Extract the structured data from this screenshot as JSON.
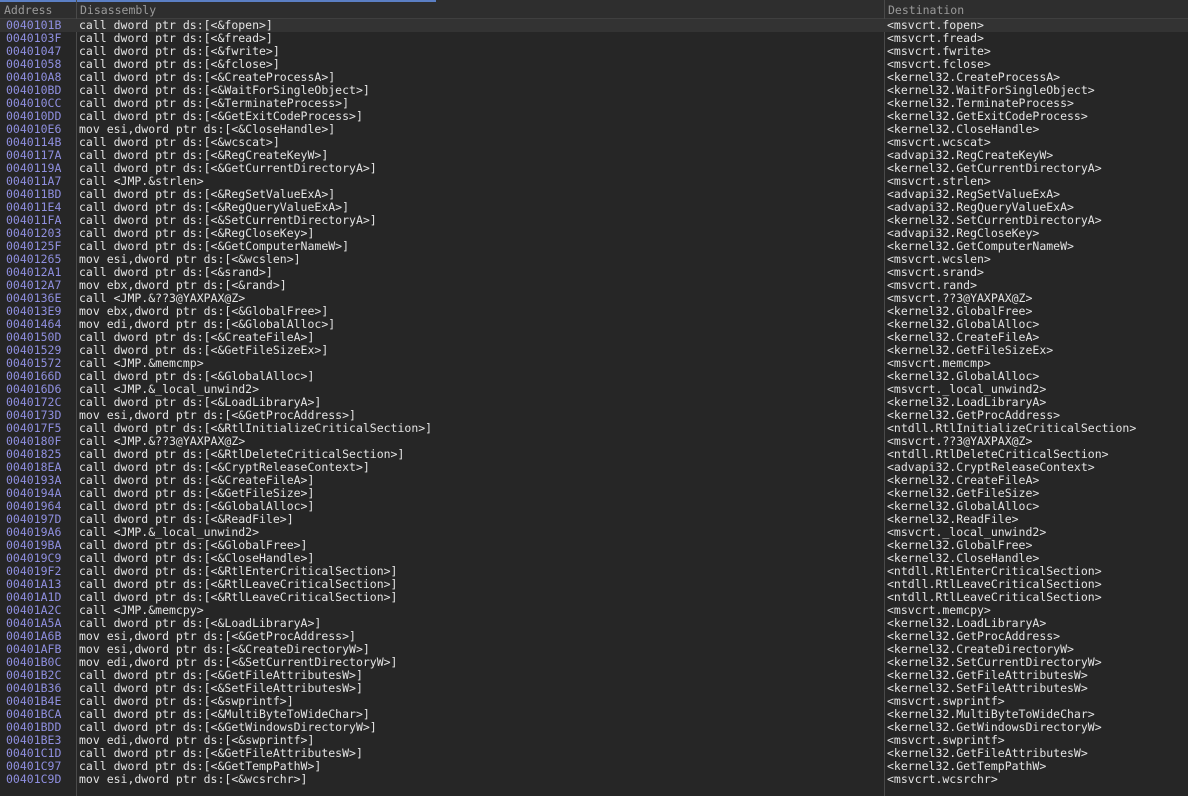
{
  "header": {
    "address": "Address",
    "disassembly": "Disassembly",
    "destination": "Destination"
  },
  "rows": [
    {
      "addr": "0040101B",
      "dis": "call dword ptr ds:[<&fopen>]",
      "dest": "<msvcrt.fopen>"
    },
    {
      "addr": "0040103F",
      "dis": "call dword ptr ds:[<&fread>]",
      "dest": "<msvcrt.fread>"
    },
    {
      "addr": "00401047",
      "dis": "call dword ptr ds:[<&fwrite>]",
      "dest": "<msvcrt.fwrite>"
    },
    {
      "addr": "00401058",
      "dis": "call dword ptr ds:[<&fclose>]",
      "dest": "<msvcrt.fclose>"
    },
    {
      "addr": "004010A8",
      "dis": "call dword ptr ds:[<&CreateProcessA>]",
      "dest": "<kernel32.CreateProcessA>"
    },
    {
      "addr": "004010BD",
      "dis": "call dword ptr ds:[<&WaitForSingleObject>]",
      "dest": "<kernel32.WaitForSingleObject>"
    },
    {
      "addr": "004010CC",
      "dis": "call dword ptr ds:[<&TerminateProcess>]",
      "dest": "<kernel32.TerminateProcess>"
    },
    {
      "addr": "004010DD",
      "dis": "call dword ptr ds:[<&GetExitCodeProcess>]",
      "dest": "<kernel32.GetExitCodeProcess>"
    },
    {
      "addr": "004010E6",
      "dis": "mov esi,dword ptr ds:[<&CloseHandle>]",
      "dest": "<kernel32.CloseHandle>"
    },
    {
      "addr": "0040114B",
      "dis": "call dword ptr ds:[<&wcscat>]",
      "dest": "<msvcrt.wcscat>"
    },
    {
      "addr": "0040117A",
      "dis": "call dword ptr ds:[<&RegCreateKeyW>]",
      "dest": "<advapi32.RegCreateKeyW>"
    },
    {
      "addr": "0040119A",
      "dis": "call dword ptr ds:[<&GetCurrentDirectoryA>]",
      "dest": "<kernel32.GetCurrentDirectoryA>"
    },
    {
      "addr": "004011A7",
      "dis": "call <JMP.&strlen>",
      "dest": "<msvcrt.strlen>"
    },
    {
      "addr": "004011BD",
      "dis": "call dword ptr ds:[<&RegSetValueExA>]",
      "dest": "<advapi32.RegSetValueExA>"
    },
    {
      "addr": "004011E4",
      "dis": "call dword ptr ds:[<&RegQueryValueExA>]",
      "dest": "<advapi32.RegQueryValueExA>"
    },
    {
      "addr": "004011FA",
      "dis": "call dword ptr ds:[<&SetCurrentDirectoryA>]",
      "dest": "<kernel32.SetCurrentDirectoryA>"
    },
    {
      "addr": "00401203",
      "dis": "call dword ptr ds:[<&RegCloseKey>]",
      "dest": "<advapi32.RegCloseKey>"
    },
    {
      "addr": "0040125F",
      "dis": "call dword ptr ds:[<&GetComputerNameW>]",
      "dest": "<kernel32.GetComputerNameW>"
    },
    {
      "addr": "00401265",
      "dis": "mov esi,dword ptr ds:[<&wcslen>]",
      "dest": "<msvcrt.wcslen>"
    },
    {
      "addr": "004012A1",
      "dis": "call dword ptr ds:[<&srand>]",
      "dest": "<msvcrt.srand>"
    },
    {
      "addr": "004012A7",
      "dis": "mov ebx,dword ptr ds:[<&rand>]",
      "dest": "<msvcrt.rand>"
    },
    {
      "addr": "0040136E",
      "dis": "call <JMP.&??3@YAXPAX@Z>",
      "dest": "<msvcrt.??3@YAXPAX@Z>"
    },
    {
      "addr": "004013E9",
      "dis": "mov ebx,dword ptr ds:[<&GlobalFree>]",
      "dest": "<kernel32.GlobalFree>"
    },
    {
      "addr": "00401464",
      "dis": "mov edi,dword ptr ds:[<&GlobalAlloc>]",
      "dest": "<kernel32.GlobalAlloc>"
    },
    {
      "addr": "0040150D",
      "dis": "call dword ptr ds:[<&CreateFileA>]",
      "dest": "<kernel32.CreateFileA>"
    },
    {
      "addr": "00401529",
      "dis": "call dword ptr ds:[<&GetFileSizeEx>]",
      "dest": "<kernel32.GetFileSizeEx>"
    },
    {
      "addr": "00401572",
      "dis": "call <JMP.&memcmp>",
      "dest": "<msvcrt.memcmp>"
    },
    {
      "addr": "0040166D",
      "dis": "call dword ptr ds:[<&GlobalAlloc>]",
      "dest": "<kernel32.GlobalAlloc>"
    },
    {
      "addr": "004016D6",
      "dis": "call <JMP.&_local_unwind2>",
      "dest": "<msvcrt._local_unwind2>"
    },
    {
      "addr": "0040172C",
      "dis": "call dword ptr ds:[<&LoadLibraryA>]",
      "dest": "<kernel32.LoadLibraryA>"
    },
    {
      "addr": "0040173D",
      "dis": "mov esi,dword ptr ds:[<&GetProcAddress>]",
      "dest": "<kernel32.GetProcAddress>"
    },
    {
      "addr": "004017F5",
      "dis": "call dword ptr ds:[<&RtlInitializeCriticalSection>]",
      "dest": "<ntdll.RtlInitializeCriticalSection>"
    },
    {
      "addr": "0040180F",
      "dis": "call <JMP.&??3@YAXPAX@Z>",
      "dest": "<msvcrt.??3@YAXPAX@Z>"
    },
    {
      "addr": "00401825",
      "dis": "call dword ptr ds:[<&RtlDeleteCriticalSection>]",
      "dest": "<ntdll.RtlDeleteCriticalSection>"
    },
    {
      "addr": "004018EA",
      "dis": "call dword ptr ds:[<&CryptReleaseContext>]",
      "dest": "<advapi32.CryptReleaseContext>"
    },
    {
      "addr": "0040193A",
      "dis": "call dword ptr ds:[<&CreateFileA>]",
      "dest": "<kernel32.CreateFileA>"
    },
    {
      "addr": "0040194A",
      "dis": "call dword ptr ds:[<&GetFileSize>]",
      "dest": "<kernel32.GetFileSize>"
    },
    {
      "addr": "00401964",
      "dis": "call dword ptr ds:[<&GlobalAlloc>]",
      "dest": "<kernel32.GlobalAlloc>"
    },
    {
      "addr": "0040197D",
      "dis": "call dword ptr ds:[<&ReadFile>]",
      "dest": "<kernel32.ReadFile>"
    },
    {
      "addr": "004019A6",
      "dis": "call <JMP.&_local_unwind2>",
      "dest": "<msvcrt._local_unwind2>"
    },
    {
      "addr": "004019BA",
      "dis": "call dword ptr ds:[<&GlobalFree>]",
      "dest": "<kernel32.GlobalFree>"
    },
    {
      "addr": "004019C9",
      "dis": "call dword ptr ds:[<&CloseHandle>]",
      "dest": "<kernel32.CloseHandle>"
    },
    {
      "addr": "004019F2",
      "dis": "call dword ptr ds:[<&RtlEnterCriticalSection>]",
      "dest": "<ntdll.RtlEnterCriticalSection>"
    },
    {
      "addr": "00401A13",
      "dis": "call dword ptr ds:[<&RtlLeaveCriticalSection>]",
      "dest": "<ntdll.RtlLeaveCriticalSection>"
    },
    {
      "addr": "00401A1D",
      "dis": "call dword ptr ds:[<&RtlLeaveCriticalSection>]",
      "dest": "<ntdll.RtlLeaveCriticalSection>"
    },
    {
      "addr": "00401A2C",
      "dis": "call <JMP.&memcpy>",
      "dest": "<msvcrt.memcpy>"
    },
    {
      "addr": "00401A5A",
      "dis": "call dword ptr ds:[<&LoadLibraryA>]",
      "dest": "<kernel32.LoadLibraryA>"
    },
    {
      "addr": "00401A6B",
      "dis": "mov esi,dword ptr ds:[<&GetProcAddress>]",
      "dest": "<kernel32.GetProcAddress>"
    },
    {
      "addr": "00401AFB",
      "dis": "mov esi,dword ptr ds:[<&CreateDirectoryW>]",
      "dest": "<kernel32.CreateDirectoryW>"
    },
    {
      "addr": "00401B0C",
      "dis": "mov edi,dword ptr ds:[<&SetCurrentDirectoryW>]",
      "dest": "<kernel32.SetCurrentDirectoryW>"
    },
    {
      "addr": "00401B2C",
      "dis": "call dword ptr ds:[<&GetFileAttributesW>]",
      "dest": "<kernel32.GetFileAttributesW>"
    },
    {
      "addr": "00401B36",
      "dis": "call dword ptr ds:[<&SetFileAttributesW>]",
      "dest": "<kernel32.SetFileAttributesW>"
    },
    {
      "addr": "00401B4E",
      "dis": "call dword ptr ds:[<&swprintf>]",
      "dest": "<msvcrt.swprintf>"
    },
    {
      "addr": "00401BCA",
      "dis": "call dword ptr ds:[<&MultiByteToWideChar>]",
      "dest": "<kernel32.MultiByteToWideChar>"
    },
    {
      "addr": "00401BDD",
      "dis": "call dword ptr ds:[<&GetWindowsDirectoryW>]",
      "dest": "<kernel32.GetWindowsDirectoryW>"
    },
    {
      "addr": "00401BE3",
      "dis": "mov edi,dword ptr ds:[<&swprintf>]",
      "dest": "<msvcrt.swprintf>"
    },
    {
      "addr": "00401C1D",
      "dis": "call dword ptr ds:[<&GetFileAttributesW>]",
      "dest": "<kernel32.GetFileAttributesW>"
    },
    {
      "addr": "00401C97",
      "dis": "call dword ptr ds:[<&GetTempPathW>]",
      "dest": "<kernel32.GetTempPathW>"
    },
    {
      "addr": "00401C9D",
      "dis": "mov esi,dword ptr ds:[<&wcsrchr>]",
      "dest": "<msvcrt.wcsrchr>"
    }
  ]
}
